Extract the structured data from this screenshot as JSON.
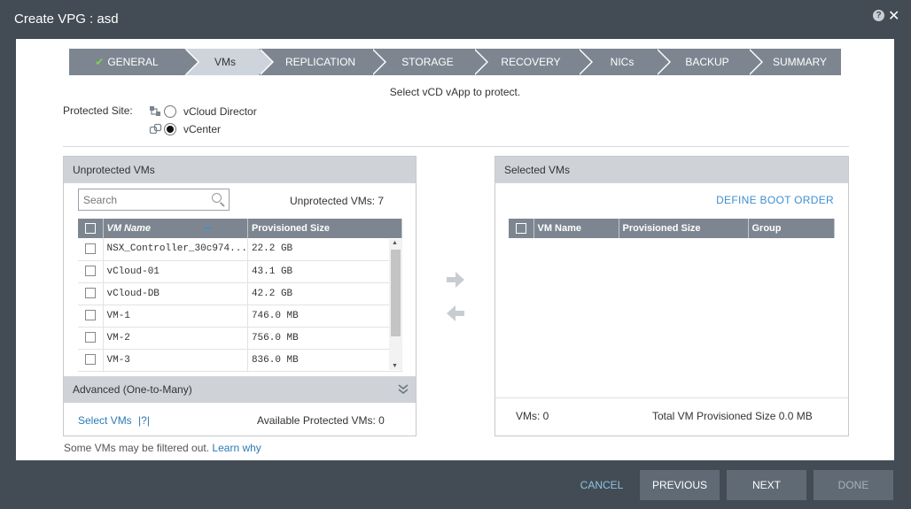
{
  "window": {
    "title": "Create VPG : asd",
    "help_icon_glyph": "?",
    "close_glyph": "✕"
  },
  "wizard": {
    "steps": [
      {
        "label": "GENERAL",
        "completed": true,
        "active": false
      },
      {
        "label": "VMs",
        "completed": false,
        "active": true
      },
      {
        "label": "REPLICATION",
        "completed": false,
        "active": false
      },
      {
        "label": "STORAGE",
        "completed": false,
        "active": false
      },
      {
        "label": "RECOVERY",
        "completed": false,
        "active": false
      },
      {
        "label": "NICs",
        "completed": false,
        "active": false
      },
      {
        "label": "BACKUP",
        "completed": false,
        "active": false
      },
      {
        "label": "SUMMARY",
        "completed": false,
        "active": false
      }
    ],
    "check_glyph": "✔"
  },
  "instruction": "Select vCD vApp to protect.",
  "protected_site": {
    "label": "Protected Site:",
    "options": [
      {
        "label": "vCloud Director",
        "selected": false,
        "icon": "vcloud-director-icon"
      },
      {
        "label": "vCenter",
        "selected": true,
        "icon": "vcenter-icon"
      }
    ]
  },
  "unprotected": {
    "title": "Unprotected VMs",
    "search_placeholder": "Search",
    "count_label": "Unprotected VMs: 7",
    "columns": [
      "VM Name",
      "Provisioned Size"
    ],
    "rows": [
      {
        "name": "NSX_Controller_30c974...",
        "size": "22.2 GB"
      },
      {
        "name": "vCloud-01",
        "size": "43.1 GB"
      },
      {
        "name": "vCloud-DB",
        "size": "42.2 GB"
      },
      {
        "name": "VM-1",
        "size": "746.0 MB"
      },
      {
        "name": "VM-2",
        "size": "756.0 MB"
      },
      {
        "name": "VM-3",
        "size": "836.0 MB"
      }
    ],
    "advanced_label": "Advanced (One-to-Many)",
    "select_vms_link": "Select VMs",
    "help_link": "|?|",
    "available_label": "Available Protected VMs: 0"
  },
  "selected": {
    "title": "Selected VMs",
    "define_boot_order": "DEFINE BOOT ORDER",
    "columns": [
      "VM Name",
      "Provisioned Size",
      "Group"
    ],
    "vms_count": "VMs: 0",
    "total_size": "Total VM Provisioned Size 0.0 MB"
  },
  "filter_note": {
    "text": "Some VMs may be filtered out.",
    "link": "Learn why"
  },
  "footer": {
    "cancel": "CANCEL",
    "previous": "PREVIOUS",
    "next": "NEXT",
    "done": "DONE"
  },
  "colors": {
    "chrome": "#434c55",
    "step": "#7d8690",
    "step_active": "#cdd4db",
    "accent": "#3f8fd0",
    "check": "#7fd44f"
  }
}
